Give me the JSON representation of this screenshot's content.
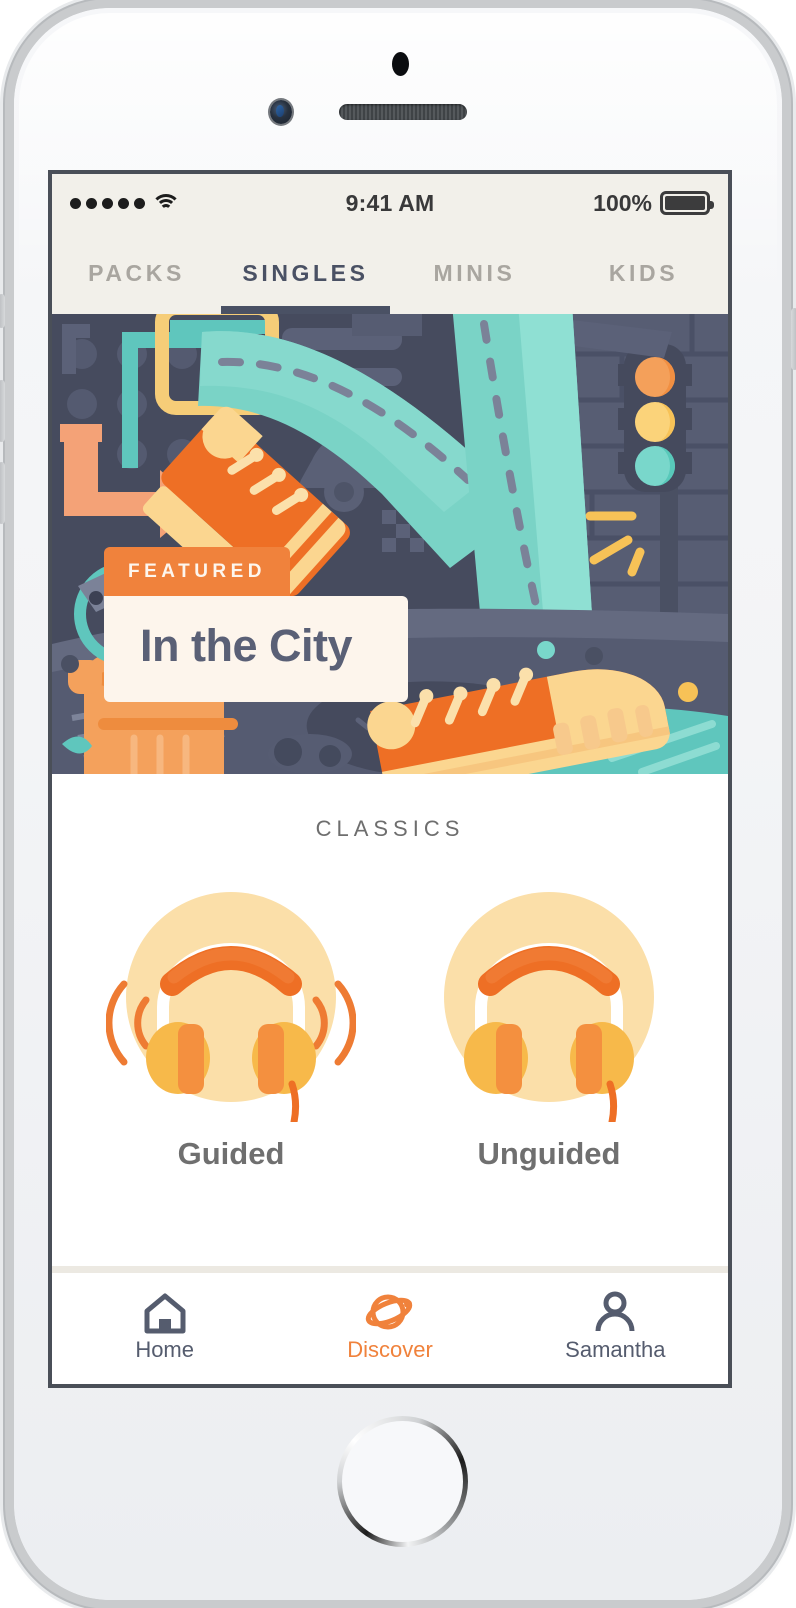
{
  "device": {
    "type": "iphone",
    "home_button": "home-button"
  },
  "status_bar": {
    "signal_icon": "signal-dots-icon",
    "wifi_icon": "wifi-icon",
    "time": "9:41 AM",
    "battery_percent": "100%",
    "battery_icon": "battery-full-icon"
  },
  "tabs": {
    "items": [
      {
        "label": "PACKS",
        "active": false
      },
      {
        "label": "SINGLES",
        "active": true
      },
      {
        "label": "MINIS",
        "active": false
      },
      {
        "label": "KIDS",
        "active": false
      }
    ]
  },
  "hero": {
    "badge": "FEATURED",
    "title": "In the City",
    "illustration": "city-street-walking-sneakers-illustration"
  },
  "classics": {
    "section_title": "CLASSICS",
    "cards": [
      {
        "label": "Guided",
        "icon": "headphones-with-soundwaves-icon"
      },
      {
        "label": "Unguided",
        "icon": "headphones-icon"
      }
    ]
  },
  "bottom_nav": {
    "items": [
      {
        "label": "Home",
        "icon": "home-icon",
        "active": false
      },
      {
        "label": "Discover",
        "icon": "planet-icon",
        "active": true
      },
      {
        "label": "Samantha",
        "icon": "person-icon",
        "active": false
      }
    ]
  },
  "colors": {
    "accent_orange": "#f0823c",
    "deep_orange": "#ef6d2b",
    "teal": "#7ad3c6",
    "slate": "#4c5165",
    "cream": "#f2f0ea",
    "card_cream": "#fdf5ec",
    "peach": "#fbdfa9",
    "yellow": "#f7c257",
    "muted_tab": "#a9a6a0"
  }
}
